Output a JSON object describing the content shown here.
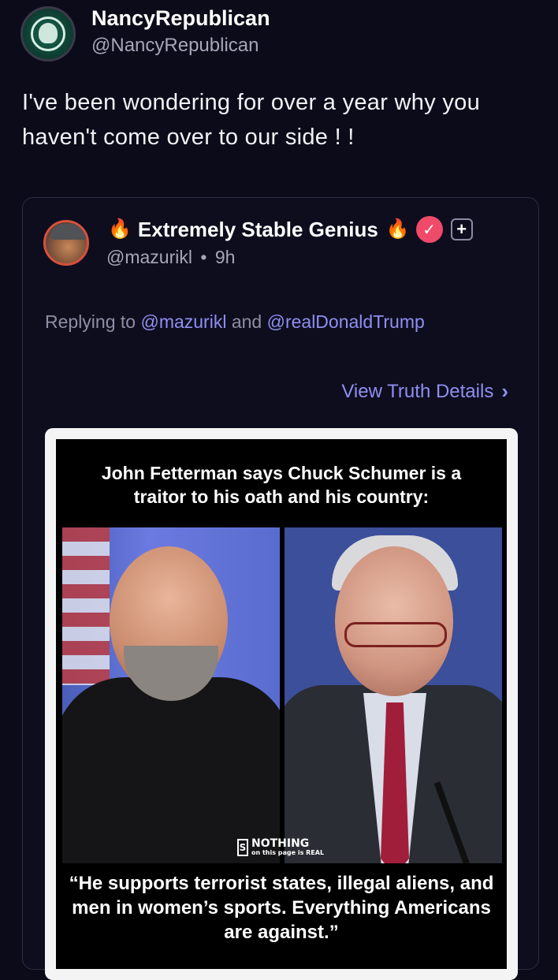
{
  "author": {
    "display_name": "NancyRepublican",
    "handle": "@NancyRepublican",
    "avatar_icon": "starbucks-logo-avatar"
  },
  "post": {
    "text": "I've been wondering for over a year why you haven't come over to our side ! !"
  },
  "quoted": {
    "display_name": "Extremely Stable Genius",
    "name_prefix_emoji": "🔥",
    "name_suffix_emoji": "🔥",
    "handle": "@mazurikl",
    "separator": "•",
    "time": "9h",
    "replying_prefix": "Replying to",
    "reply_mention_1": "@mazurikl",
    "reply_and": "and",
    "reply_mention_2": "@realDonaldTrump",
    "view_details_label": "View Truth Details",
    "verified_color": "#f04a6a",
    "link_color": "#8f8ff2"
  },
  "meme": {
    "title": "John Fetterman says Chuck Schumer is a traitor to his oath and his country:",
    "quote": "“He supports terrorist states, illegal aliens, and men in women’s sports. Everything Americans are against.”",
    "watermark_main": "NOTHING",
    "watermark_sub": "on this page is REAL",
    "watermark_letter": "S"
  }
}
